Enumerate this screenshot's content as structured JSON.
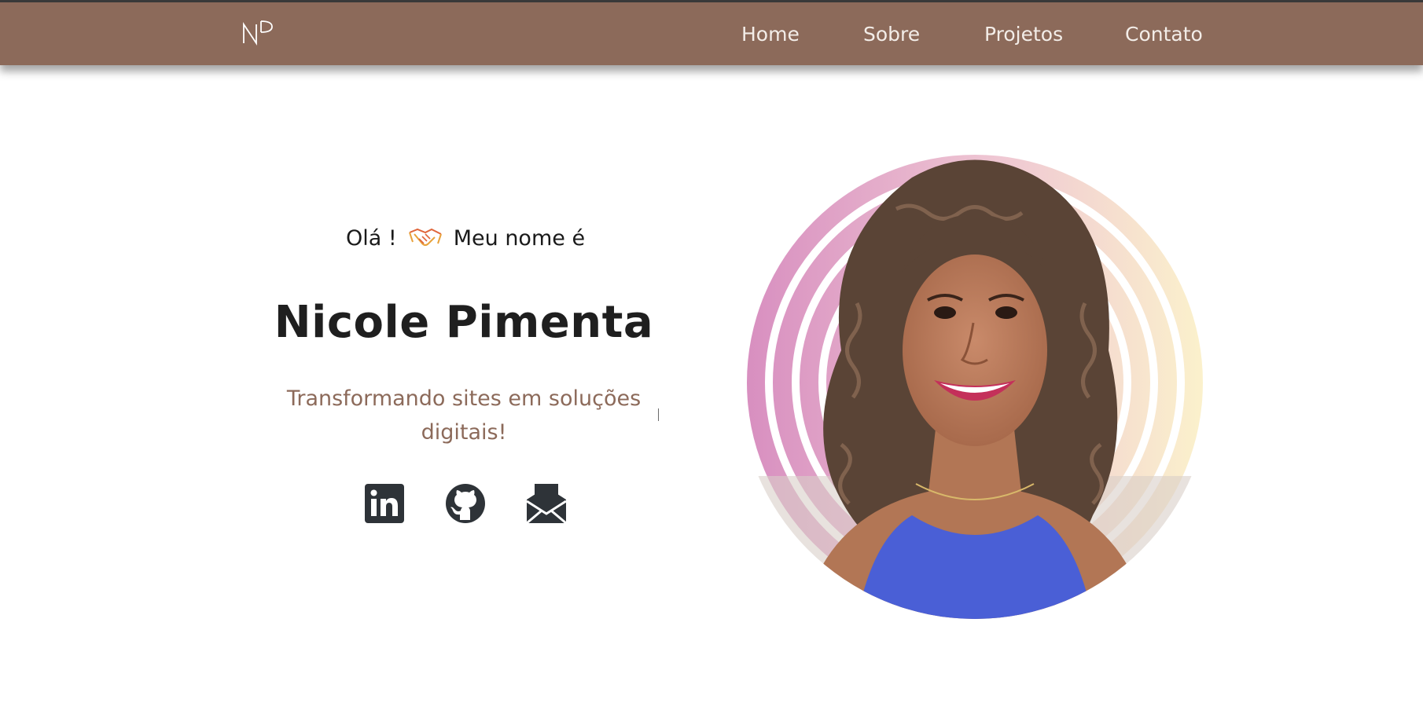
{
  "nav": {
    "logo_text": "NP",
    "items": [
      {
        "label": "Home"
      },
      {
        "label": "Sobre"
      },
      {
        "label": "Projetos"
      },
      {
        "label": "Contato"
      }
    ]
  },
  "hero": {
    "greeting_before": "Olá !",
    "greeting_icon": "handshake-icon",
    "greeting_after": "Meu nome é",
    "name": "Nicole Pimenta",
    "tagline": "Transformando sites em soluções digitais!",
    "social": [
      {
        "icon": "linkedin-icon"
      },
      {
        "icon": "github-icon"
      },
      {
        "icon": "email-icon"
      }
    ],
    "photo": "profile-photo"
  },
  "colors": {
    "navbar": "#8c6a5a",
    "nav_text": "#f3ede8",
    "accent": "#8c6a5a",
    "text_dark": "#1f1f1f",
    "icon_dark": "#2e3338",
    "ring_pink": "#d9a0c6",
    "ring_yellow": "#f7ecc2"
  }
}
